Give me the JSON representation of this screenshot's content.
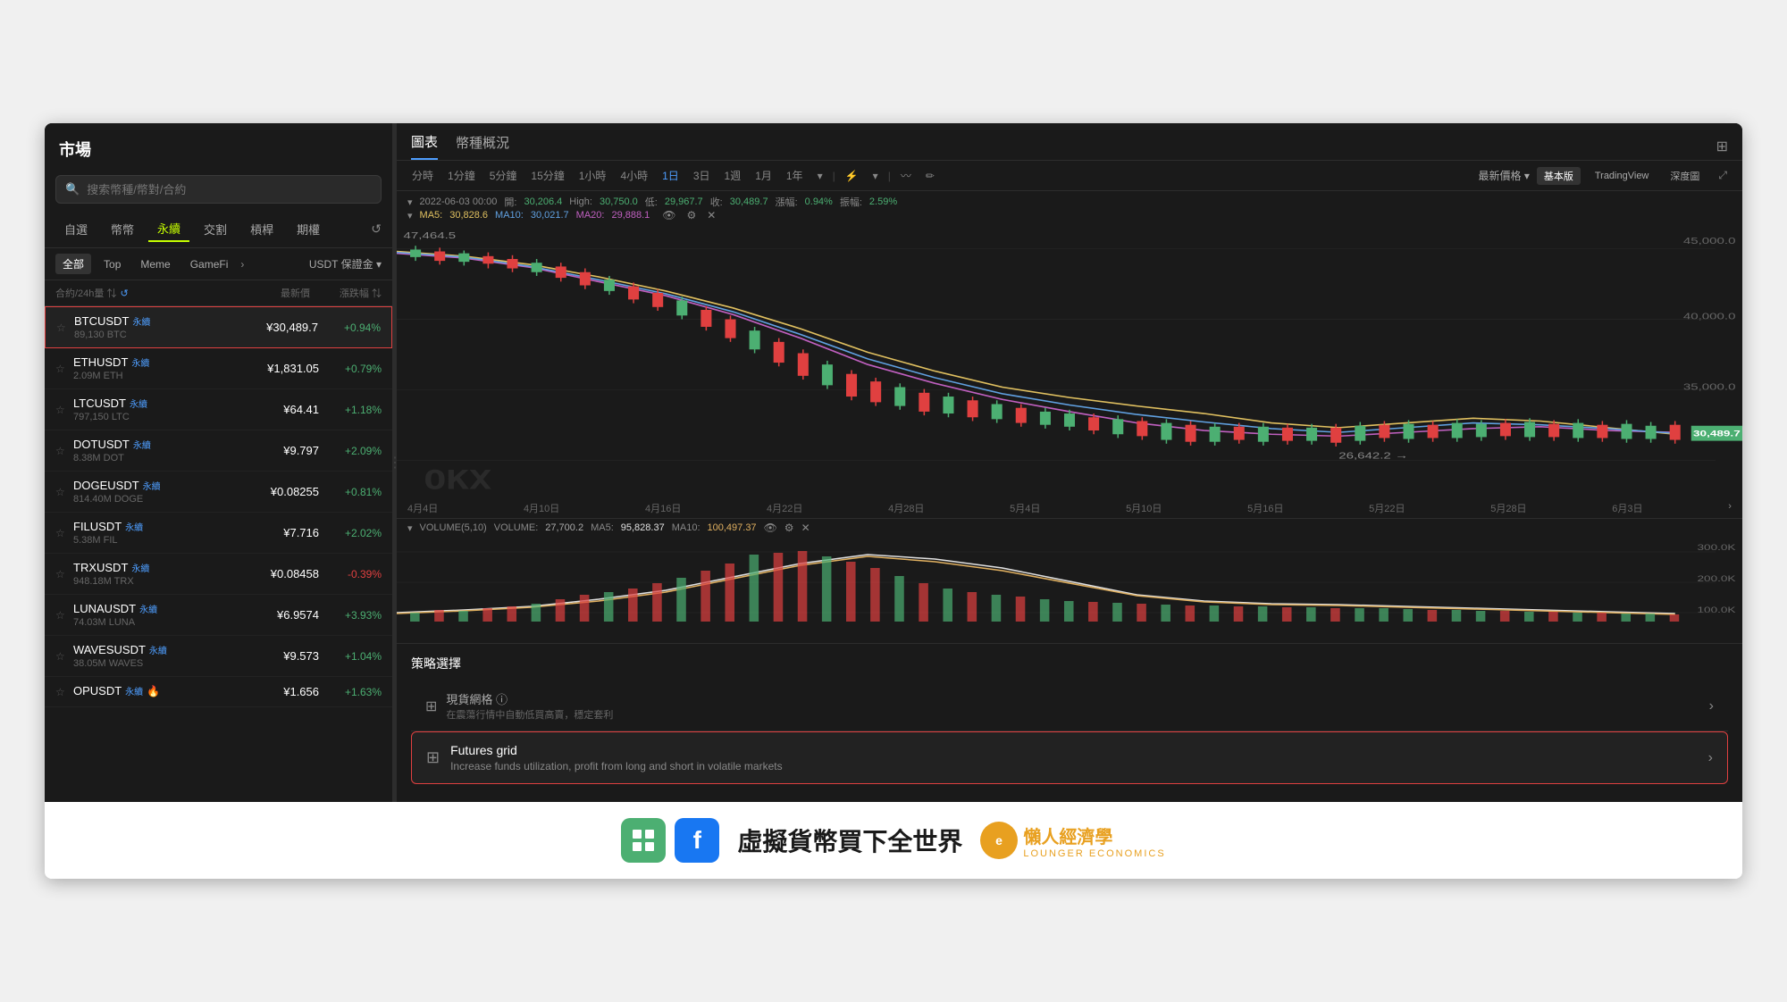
{
  "sidebar": {
    "title": "市場",
    "search_placeholder": "搜索幣種/幣對/合約",
    "tabs": [
      "自選",
      "幣幣",
      "永續",
      "交割",
      "槓桿",
      "期權"
    ],
    "active_tab": "永續",
    "filters": [
      "全部",
      "Top",
      "Meme",
      "GameFi"
    ],
    "filter_more": "›",
    "filter_dropdown": "USDT 保證金 ▾",
    "list_header": {
      "col1": "合約/24h量 ⇅ ↺",
      "col2": "最新價",
      "col3": "漲跌幅 ⇅"
    },
    "coins": [
      {
        "symbol": "BTCUSDT",
        "tag": "永續",
        "volume": "89,130 BTC",
        "price": "¥30,489.7",
        "change": "+0.94%",
        "positive": true,
        "selected": true
      },
      {
        "symbol": "ETHUSDT",
        "tag": "永續",
        "volume": "2.09M ETH",
        "price": "¥1,831.05",
        "change": "+0.79%",
        "positive": true,
        "selected": false
      },
      {
        "symbol": "LTCUSDT",
        "tag": "永續",
        "volume": "797,150 LTC",
        "price": "¥64.41",
        "change": "+1.18%",
        "positive": true,
        "selected": false
      },
      {
        "symbol": "DOTUSDT",
        "tag": "永續",
        "volume": "8.38M DOT",
        "price": "¥9.797",
        "change": "+2.09%",
        "positive": true,
        "selected": false
      },
      {
        "symbol": "DOGEUSDT",
        "tag": "永續",
        "volume": "814.40M DOGE",
        "price": "¥0.08255",
        "change": "+0.81%",
        "positive": true,
        "selected": false
      },
      {
        "symbol": "FILUSDT",
        "tag": "永續",
        "volume": "5.38M FIL",
        "price": "¥7.716",
        "change": "+2.02%",
        "positive": true,
        "selected": false
      },
      {
        "symbol": "TRXUSDT",
        "tag": "永續",
        "volume": "948.18M TRX",
        "price": "¥0.08458",
        "change": "-0.39%",
        "positive": false,
        "selected": false
      },
      {
        "symbol": "LUNAUSDT",
        "tag": "永續",
        "volume": "74.03M LUNA",
        "price": "¥6.9574",
        "change": "+3.93%",
        "positive": true,
        "selected": false
      },
      {
        "symbol": "WAVESUSDT",
        "tag": "永續",
        "volume": "38.05M WAVES",
        "price": "¥9.573",
        "change": "+1.04%",
        "positive": true,
        "selected": false
      },
      {
        "symbol": "OPUSDT",
        "tag": "永續",
        "volume": "",
        "price": "¥1.656",
        "change": "+1.63%",
        "positive": true,
        "selected": false,
        "fire": true
      }
    ]
  },
  "chart": {
    "panel_tabs": [
      "圖表",
      "幣種概況"
    ],
    "active_tab": "圖表",
    "time_buttons": [
      "分時",
      "1分鐘",
      "5分鐘",
      "15分鐘",
      "1小時",
      "4小時",
      "1日",
      "3日",
      "1週",
      "1月",
      "1年"
    ],
    "active_time": "1日",
    "indicator_btn": "⚡",
    "price_mode": "最新價格 ▾",
    "view_modes": [
      "基本版",
      "TradingView",
      "深度圖"
    ],
    "active_view": "基本版",
    "info_row1": "▾ 2022-06-03 00:00  開: 30,206.4  High: 30,750.0  低: 29,967.7  收: 30,489.7  漲幅: 0.94%  振幅: 2.59%",
    "ma_row": "▾ MA5: 30,828.6  MA10: 30,021.7  MA20: 29,888.1",
    "price_high": "47,464.5",
    "price_low": "26,642.2",
    "current_price": "30,489.7",
    "dates": [
      "4月4日",
      "4月10日",
      "4月16日",
      "4月22日",
      "4月28日",
      "5月4日",
      "5月10日",
      "5月16日",
      "5月22日",
      "5月28日",
      "6月3日"
    ],
    "y_axis_prices": [
      "45,000.0",
      "40,000.0",
      "35,000.0"
    ],
    "volume_info": "▾ VOLUME(5,10)  VOLUME: 27,700.2  MA5: 95,828.37  MA10: 100,497.37",
    "volume_y_axis": [
      "300.0K",
      "200.0K",
      "100.0K"
    ],
    "strategy": {
      "title": "策略選擇",
      "spot_grid_name": "現貨網格 ⓘ",
      "spot_grid_desc": "在震蕩行情中自動低買高賣，穩定套利",
      "futures_grid_name": "Futures grid",
      "futures_grid_desc": "Increase funds utilization, profit from long and short in volatile markets"
    }
  },
  "banner": {
    "text": "虛擬貨幣買下全世界",
    "lounger_name": "懶人經濟學",
    "lounger_sub": "LOUNGER ECONOMICS"
  }
}
